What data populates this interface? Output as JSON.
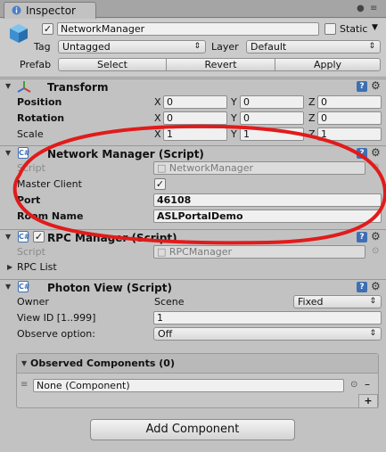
{
  "tab": {
    "title": "Inspector"
  },
  "gameobject": {
    "name": "NetworkManager",
    "static_label": "Static",
    "tag_label": "Tag",
    "tag_value": "Untagged",
    "layer_label": "Layer",
    "layer_value": "Default",
    "prefab_label": "Prefab",
    "prefab_buttons": [
      "Select",
      "Revert",
      "Apply"
    ]
  },
  "transform": {
    "title": "Transform",
    "rows": [
      {
        "label": "Position",
        "x": "0",
        "y": "0",
        "z": "0"
      },
      {
        "label": "Rotation",
        "x": "0",
        "y": "0",
        "z": "0"
      },
      {
        "label": "Scale",
        "x": "1",
        "y": "1",
        "z": "1"
      }
    ],
    "axes": [
      "X",
      "Y",
      "Z"
    ]
  },
  "network_manager": {
    "title": "Network Manager (Script)",
    "script_label": "Script",
    "script_value": "NetworkManager",
    "master_client_label": "Master Client",
    "port_label": "Port",
    "port_value": "46108",
    "room_name_label": "Room Name",
    "room_name_value": "ASLPortalDemo"
  },
  "rpc_manager": {
    "title": "RPC Manager (Script)",
    "script_label": "Script",
    "script_value": "RPCManager",
    "rpc_list_label": "RPC List"
  },
  "photon_view": {
    "title": "Photon View (Script)",
    "owner_label": "Owner",
    "owner_value": "Scene",
    "owner_mode": "Fixed",
    "view_id_label": "View ID [1..999]",
    "view_id_value": "1",
    "observe_label": "Observe option:",
    "observe_value": "Off",
    "observed_title": "Observed Components (0)",
    "observed_item": "None (Component)"
  },
  "footer": {
    "add_component": "Add Component"
  },
  "colors": {
    "annotation": "#e11b1b",
    "icon_blue": "#3e6fb3"
  }
}
